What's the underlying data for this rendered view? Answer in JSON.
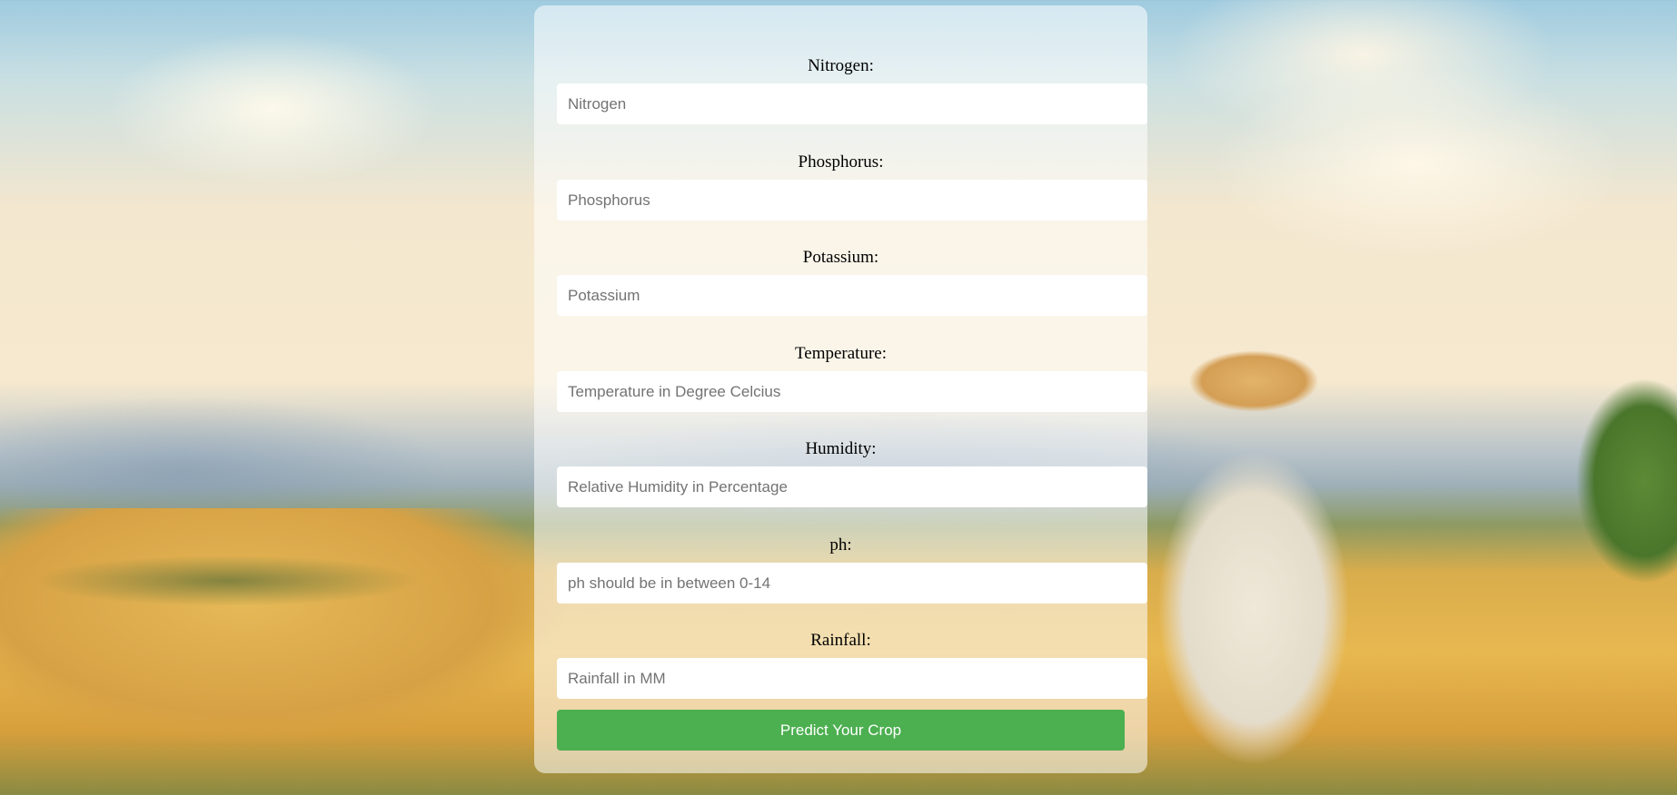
{
  "form": {
    "fields": [
      {
        "label": "Nitrogen:",
        "placeholder": "Nitrogen",
        "value": ""
      },
      {
        "label": "Phosphorus:",
        "placeholder": "Phosphorus",
        "value": ""
      },
      {
        "label": "Potassium:",
        "placeholder": "Potassium",
        "value": ""
      },
      {
        "label": "Temperature:",
        "placeholder": "Temperature in Degree Celcius",
        "value": ""
      },
      {
        "label": "Humidity:",
        "placeholder": "Relative Humidity in Percentage",
        "value": ""
      },
      {
        "label": "ph:",
        "placeholder": "ph should be in between 0-14",
        "value": ""
      },
      {
        "label": "Rainfall:",
        "placeholder": "Rainfall in MM",
        "value": ""
      }
    ],
    "submit_label": "Predict Your Crop",
    "submit_color": "#4caf50"
  }
}
